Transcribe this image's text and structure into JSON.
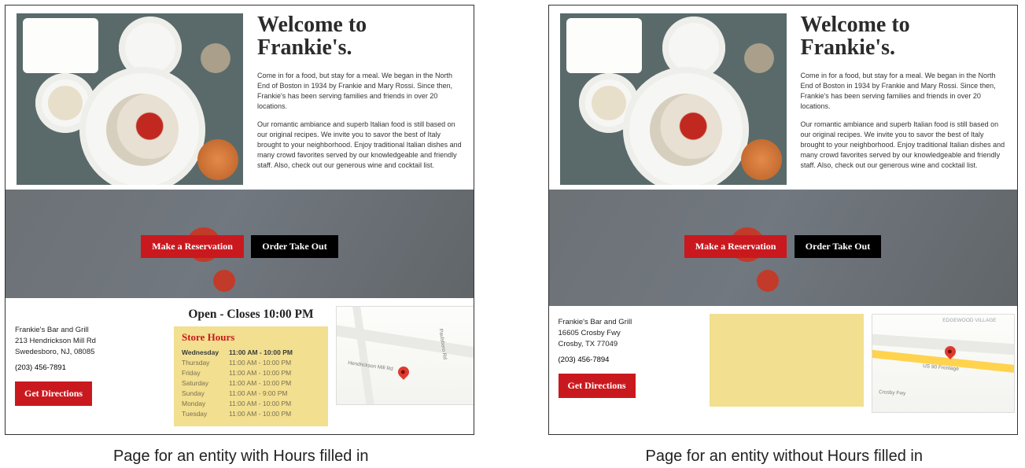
{
  "heading": "Welcome to Frankie's.",
  "para1": "Come in for a food, but stay for a meal. We began in the North End of Boston in 1934 by Frankie and Mary Rossi. Since then, Frankie's has been serving families and friends in over 20 locations.",
  "para2": "Our romantic ambiance and superb Italian food is still based on our original recipes. We invite you to savor the best of Italy brought to your neighborhood. Enjoy traditional Italian dishes and many crowd favorites served by our knowledgeable and friendly staff. Also, check out our generous wine and cocktail list.",
  "cta": {
    "reserve": "Make a Reservation",
    "takeout": "Order Take Out"
  },
  "directions_label": "Get Directions",
  "left": {
    "name": "Frankie's Bar and Grill",
    "street": "213 Hendrickson Mill Rd",
    "city": "Swedesboro, NJ, 08085",
    "phone": "(203) 456-7891",
    "status": "Open - Closes 10:00 PM",
    "hours_header": "Store Hours",
    "hours": [
      {
        "day": "Wednesday",
        "time": "11:00 AM - 10:00 PM",
        "today": true
      },
      {
        "day": "Thursday",
        "time": "11:00 AM - 10:00 PM",
        "today": false
      },
      {
        "day": "Friday",
        "time": "11:00 AM - 10:00 PM",
        "today": false
      },
      {
        "day": "Saturday",
        "time": "11:00 AM - 10:00 PM",
        "today": false
      },
      {
        "day": "Sunday",
        "time": "11:00 AM - 9:00 PM",
        "today": false
      },
      {
        "day": "Monday",
        "time": "11:00 AM - 10:00 PM",
        "today": false
      },
      {
        "day": "Tuesday",
        "time": "11:00 AM - 10:00 PM",
        "today": false
      }
    ],
    "map_labels": [
      "Hendrickson Mill Rd",
      "Paulsboro Rd"
    ],
    "caption": "Page for an entity with Hours filled in"
  },
  "right": {
    "name": "Frankie's Bar and Grill",
    "street": "16605 Crosby Fwy",
    "city": "Crosby, TX 77049",
    "phone": "(203) 456-7894",
    "map_labels": [
      "EDGEWOOD VILLAGE",
      "US 90 Frontage",
      "Crosby Fwy"
    ],
    "caption": "Page for an entity without Hours filled in"
  }
}
